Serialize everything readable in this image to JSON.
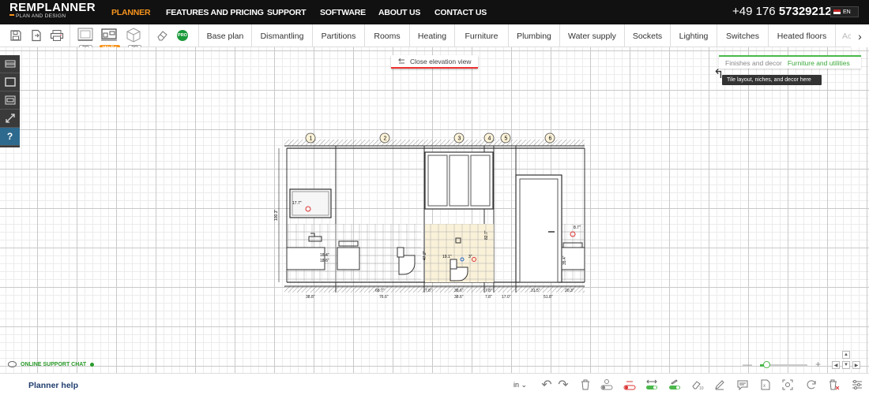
{
  "brand": {
    "logo_top": "REMPLANNER",
    "logo_sub": "PLAN AND DESIGN",
    "accent": "#f7941d"
  },
  "nav": {
    "items": [
      {
        "label": "PLANNER",
        "active": true
      },
      {
        "label": "FEATURES AND PRICING"
      },
      {
        "label": "SUPPORT"
      },
      {
        "label": "SOFTWARE"
      },
      {
        "label": "ABOUT US"
      },
      {
        "label": "CONTACT US"
      }
    ],
    "phone_prefix": "+49 176",
    "phone_number": "57329212",
    "language": "EN"
  },
  "toolbar": {
    "icons": [
      "save-icon",
      "export-icon",
      "print-icon"
    ],
    "views": {
      "v2d": "2D",
      "walls": "Walls",
      "v3d": "3D"
    },
    "pro": "PRO",
    "tabs": [
      "Base plan",
      "Dismantling",
      "Partitions",
      "Rooms",
      "Heating",
      "Furniture",
      "Plumbing",
      "Water supply",
      "Sockets",
      "Lighting",
      "Switches",
      "Heated floors",
      "Ac"
    ]
  },
  "canvas": {
    "close_elevation": "Close elevation view",
    "tab_finishes": "Finishes and decor",
    "tab_furniture": "Furniture and utilities",
    "tooltip": "Tile layout, niches, and decor here"
  },
  "drawing": {
    "markers": [
      "1",
      "2",
      "3",
      "4",
      "5",
      "6"
    ],
    "dims": {
      "height_total": "100.3\"",
      "mirror": "17.7\"",
      "d184": "18.4\"",
      "d186": "18.6\"",
      "d191": "19.1\"",
      "d472": "47.2\"",
      "d472b": "47.2\"",
      "d827": "82.7\"",
      "d87": "8.7\"",
      "d354": "35.4\"",
      "d22": "22.5\"",
      "d394": "39.4\"",
      "d9": "3\"",
      "bottom1a": "38.8\"",
      "bottom2a": "68.7\"",
      "bottom2b": "76.6\"",
      "bottom3": "7.8\"",
      "bottom4a": "38.6\"",
      "bottom4b": "38.6\"",
      "bottom5": "7.8\"",
      "bottom5b": "7.8\"",
      "bottom6": "17.0\"",
      "bottom7": "31.5\"",
      "bottom7b": "51.8\"",
      "bottom8": "20.3\""
    }
  },
  "support": {
    "label": "ONLINE SUPPORT CHAT"
  },
  "zoom": {
    "level": 0.1
  },
  "bottom": {
    "help": "Planner help",
    "unit": "in"
  }
}
